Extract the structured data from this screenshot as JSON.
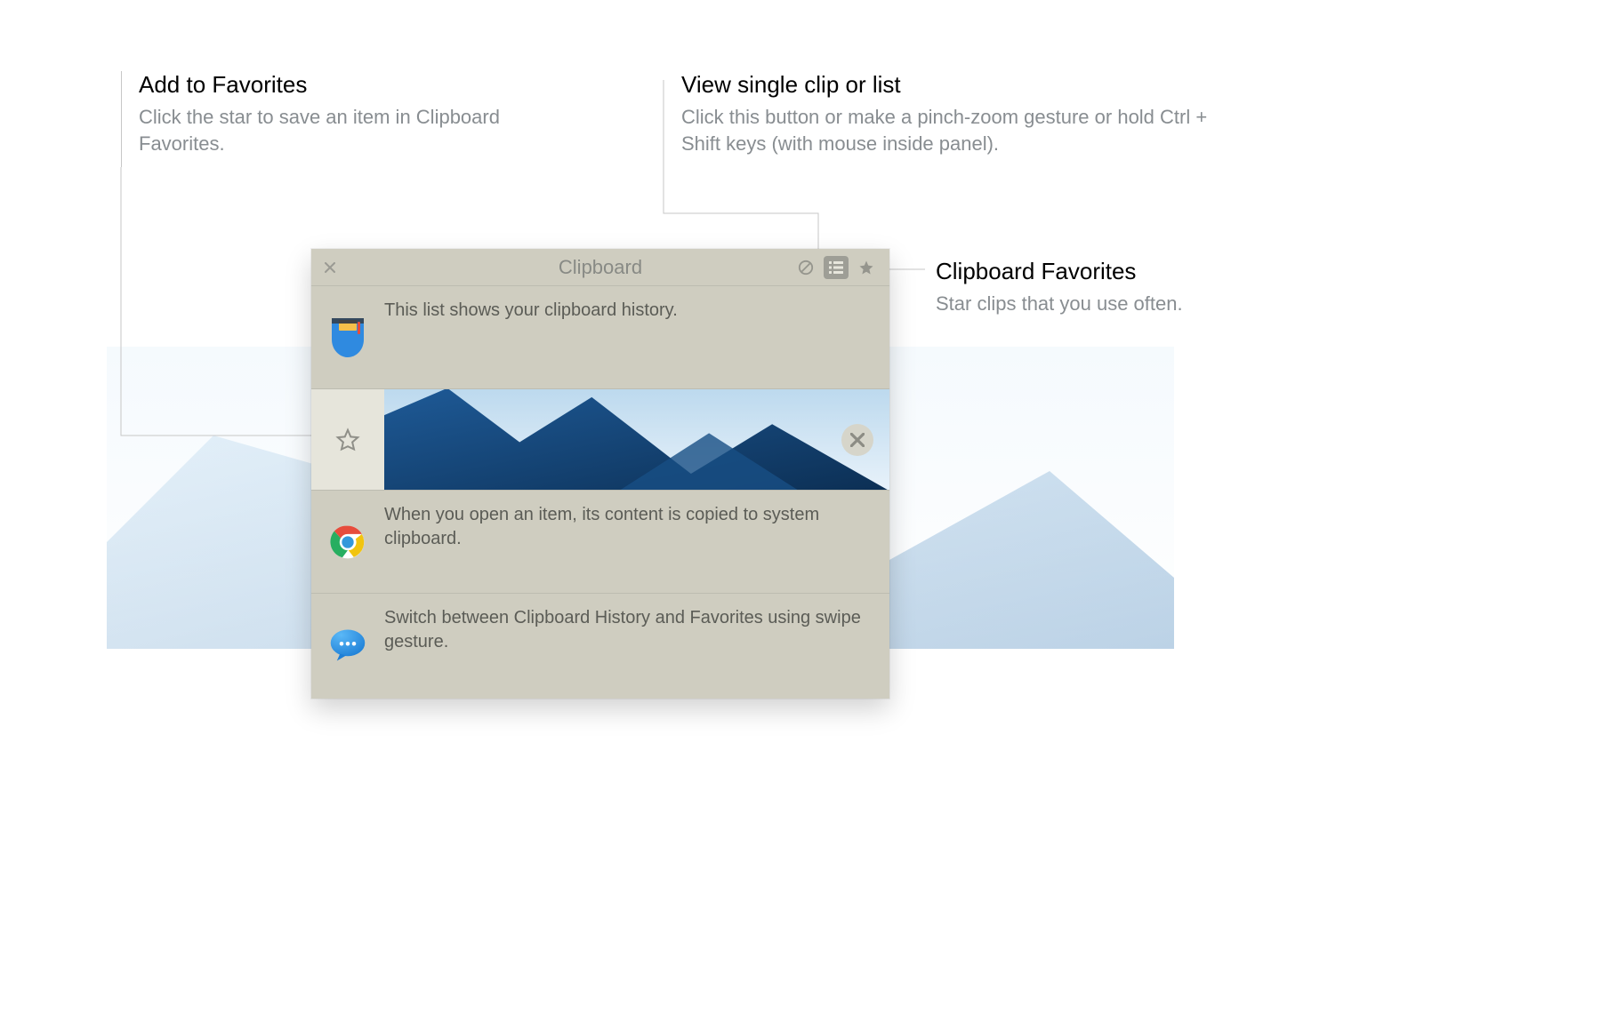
{
  "callouts": {
    "add_favorites": {
      "title": "Add to Favorites",
      "body": "Click the star to save an item in Clipboard Favorites."
    },
    "view_mode": {
      "title": "View single clip or list",
      "body": "Click this button or make a pinch-zoom gesture or hold Ctrl + Shift keys (with mouse inside panel)."
    },
    "favorites": {
      "title": "Clipboard Favorites",
      "body": "Star clips that you use often."
    }
  },
  "panel": {
    "title": "Clipboard",
    "header_icons": {
      "close": "close-icon",
      "clear": "no-entry-icon",
      "list": "list-icon",
      "star": "star-icon"
    },
    "rows": [
      {
        "icon": "pocket-icon",
        "text": "This list shows your clipboard history."
      },
      {
        "icon": "star-outline-icon",
        "type": "image",
        "delete_icon": "close-icon"
      },
      {
        "icon": "chrome-icon",
        "text": "When you open an item, its content is copied to system clipboard."
      },
      {
        "icon": "messages-icon",
        "text": "Switch between Clipboard History and Favorites using swipe gesture."
      }
    ]
  },
  "colors": {
    "panel_bg": "#cfcdc0",
    "panel_border": "#bdbcb1",
    "text_muted": "#888d91",
    "text_row": "#5b5c56"
  }
}
